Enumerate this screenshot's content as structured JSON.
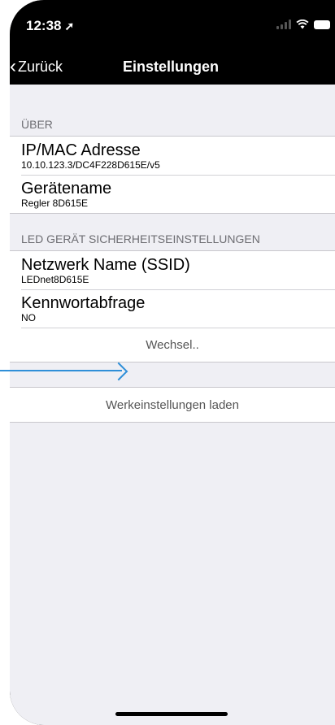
{
  "status_bar": {
    "time": "12:38",
    "location_glyph": "➚",
    "icons": [
      "signal-icon",
      "wifi-icon",
      "battery-icon"
    ]
  },
  "nav": {
    "back_label": "Zurück",
    "title": "Einstellungen"
  },
  "sections": {
    "about": {
      "header": "ÜBER",
      "rows": [
        {
          "title": "IP/MAC Adresse",
          "value": "10.10.123.3/DC4F228D615E/v5"
        },
        {
          "title": "Gerätename",
          "value": "Regler 8D615E"
        }
      ]
    },
    "security": {
      "header": "LED GERÄT SICHERHEITSEINSTELLUNGEN",
      "rows": [
        {
          "title": "Netzwerk Name (SSID)",
          "value": "LEDnet8D615E"
        },
        {
          "title": "Kennwortabfrage",
          "value": "NO"
        }
      ],
      "action": "Wechsel.."
    },
    "factory": {
      "action": "Werkeinstellungen laden"
    }
  },
  "colors": {
    "accent_arrow": "#2f8fd8",
    "background": "#efeff4",
    "navbar": "#000000"
  }
}
